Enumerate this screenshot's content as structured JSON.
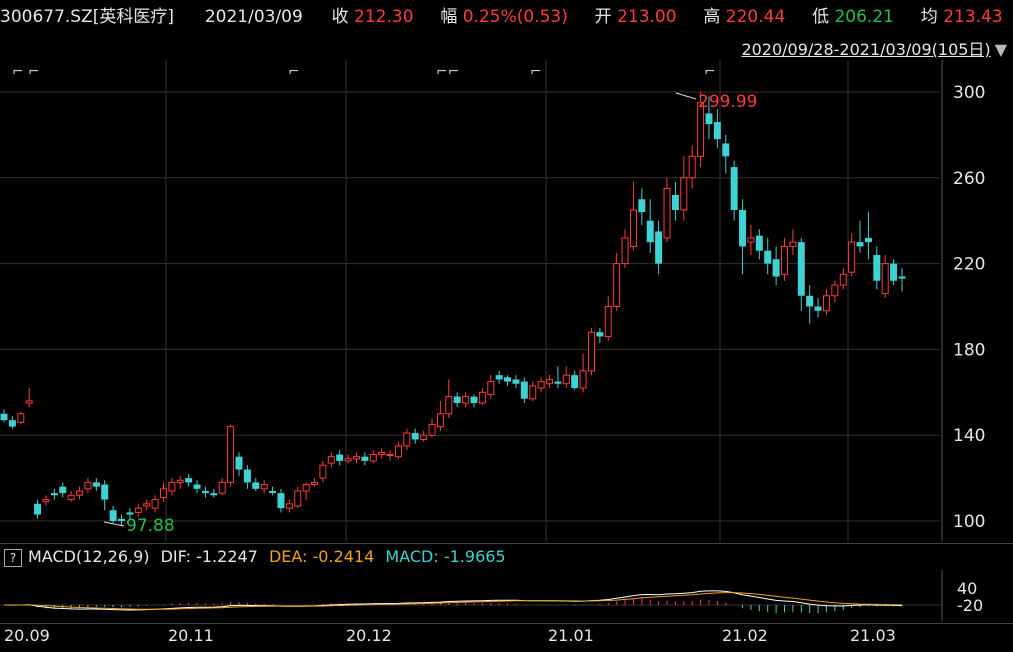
{
  "header": {
    "code": "300677.SZ[英科医疗]",
    "date": "2021/03/09",
    "close_label": "收",
    "close_value": "212.30",
    "change_label": "幅",
    "change_value": "0.25%(0.53)",
    "open_label": "开",
    "open_value": "213.00",
    "high_label": "高",
    "high_value": "220.44",
    "low_label": "低",
    "low_value": "206.21",
    "avg_label": "均",
    "avg_value": "213.43"
  },
  "range_selector": {
    "label": "2020/09/28-2021/03/09(105日)"
  },
  "price_axis": {
    "ticks": [
      "300",
      "260",
      "220",
      "180",
      "140",
      "100"
    ]
  },
  "annotations": {
    "high_marker": "299.99",
    "low_marker": "97.88"
  },
  "macd": {
    "help": "?",
    "title": "MACD(12,26,9)",
    "dif_label": "DIF:",
    "dif_value": "-1.2247",
    "dea_label": "DEA:",
    "dea_value": "-0.2414",
    "macd_label": "MACD:",
    "macd_value": "-1.9665",
    "axis_ticks": [
      "40",
      "-20"
    ]
  },
  "x_axis": {
    "labels": [
      "20.09",
      "20.11",
      "20.12",
      "21.01",
      "21.02",
      "21.03"
    ]
  },
  "colors": {
    "up": "#ff3b3b",
    "down": "#3fd2d2",
    "dif": "#ffffff",
    "dea": "#f2a11b",
    "grid": "#333333"
  },
  "chart_data": {
    "type": "candlestick",
    "y_range": [
      90,
      310
    ],
    "candles": [
      [
        150,
        147,
        152,
        146
      ],
      [
        147,
        144,
        149,
        143
      ],
      [
        146,
        150,
        151,
        145
      ],
      [
        155,
        156,
        162,
        153
      ],
      [
        108,
        103,
        110,
        101
      ],
      [
        109,
        110,
        112,
        107
      ],
      [
        113,
        112,
        115,
        110
      ],
      [
        116,
        113,
        118,
        111
      ],
      [
        110,
        112,
        114,
        109
      ],
      [
        112,
        114,
        116,
        110
      ],
      [
        115,
        118,
        120,
        113
      ],
      [
        118,
        116,
        120,
        114
      ],
      [
        117,
        110,
        119,
        105
      ],
      [
        105,
        100,
        107,
        99
      ],
      [
        101,
        100,
        103,
        98
      ],
      [
        104,
        103,
        106,
        101
      ],
      [
        104,
        106,
        108,
        102
      ],
      [
        107,
        108,
        110,
        105
      ],
      [
        106,
        110,
        112,
        104
      ],
      [
        111,
        115,
        118,
        109
      ],
      [
        114,
        118,
        120,
        112
      ],
      [
        118,
        119,
        121,
        115
      ],
      [
        120,
        118,
        122,
        116
      ],
      [
        117,
        115,
        119,
        113
      ],
      [
        114,
        113,
        116,
        111
      ],
      [
        113,
        112,
        115,
        111
      ],
      [
        113,
        118,
        120,
        112
      ],
      [
        118,
        144,
        145,
        116
      ],
      [
        130,
        124,
        132,
        121
      ],
      [
        124,
        118,
        126,
        115
      ],
      [
        118,
        115,
        120,
        114
      ],
      [
        115,
        117,
        119,
        113
      ],
      [
        114,
        113,
        116,
        112
      ],
      [
        113,
        106,
        115,
        104
      ],
      [
        106,
        108,
        110,
        104
      ],
      [
        107,
        114,
        116,
        106
      ],
      [
        114,
        117,
        118,
        110
      ],
      [
        117,
        118,
        120,
        116
      ],
      [
        120,
        126,
        128,
        118
      ],
      [
        127,
        130,
        132,
        125
      ],
      [
        131,
        128,
        133,
        126
      ],
      [
        128,
        129,
        131,
        127
      ],
      [
        129,
        130,
        132,
        127
      ],
      [
        130,
        128,
        132,
        126
      ],
      [
        128,
        131,
        133,
        127
      ],
      [
        131,
        132,
        134,
        129
      ],
      [
        131,
        131,
        133,
        128
      ],
      [
        130,
        135,
        137,
        129
      ],
      [
        135,
        141,
        143,
        133
      ],
      [
        141,
        138,
        143,
        136
      ],
      [
        138,
        140,
        142,
        137
      ],
      [
        140,
        145,
        148,
        139
      ],
      [
        144,
        150,
        156,
        142
      ],
      [
        150,
        158,
        166,
        148
      ],
      [
        158,
        155,
        160,
        153
      ],
      [
        155,
        158,
        160,
        153
      ],
      [
        158,
        155,
        159,
        153
      ],
      [
        155,
        160,
        162,
        154
      ],
      [
        159,
        165,
        168,
        157
      ],
      [
        168,
        166,
        170,
        164
      ],
      [
        167,
        165,
        168,
        163
      ],
      [
        166,
        164,
        168,
        162
      ],
      [
        165,
        157,
        167,
        155
      ],
      [
        157,
        163,
        165,
        156
      ],
      [
        162,
        165,
        167,
        160
      ],
      [
        164,
        166,
        168,
        162
      ],
      [
        165,
        164,
        172,
        162
      ],
      [
        164,
        168,
        172,
        162
      ],
      [
        168,
        162,
        170,
        161
      ],
      [
        162,
        170,
        178,
        160
      ],
      [
        170,
        188,
        190,
        168
      ],
      [
        188,
        186,
        190,
        183
      ],
      [
        186,
        200,
        205,
        184
      ],
      [
        200,
        220,
        225,
        198
      ],
      [
        220,
        232,
        236,
        218
      ],
      [
        228,
        245,
        258,
        226
      ],
      [
        250,
        244,
        255,
        238
      ],
      [
        240,
        230,
        250,
        225
      ],
      [
        235,
        220,
        240,
        215
      ],
      [
        232,
        255,
        260,
        230
      ],
      [
        252,
        245,
        258,
        240
      ],
      [
        245,
        260,
        270,
        240
      ],
      [
        260,
        270,
        275,
        255
      ],
      [
        270,
        295,
        300,
        265
      ],
      [
        290,
        285,
        298,
        278
      ],
      [
        286,
        278,
        292,
        274
      ],
      [
        276,
        270,
        280,
        262
      ],
      [
        265,
        245,
        268,
        240
      ],
      [
        245,
        228,
        250,
        215
      ],
      [
        230,
        232,
        238,
        224
      ],
      [
        233,
        226,
        236,
        222
      ],
      [
        226,
        220,
        232,
        215
      ],
      [
        222,
        214,
        228,
        210
      ],
      [
        215,
        228,
        232,
        212
      ],
      [
        228,
        230,
        236,
        224
      ],
      [
        230,
        205,
        232,
        198
      ],
      [
        205,
        200,
        210,
        192
      ],
      [
        200,
        198,
        204,
        195
      ],
      [
        198,
        205,
        208,
        196
      ],
      [
        205,
        210,
        212,
        202
      ],
      [
        210,
        215,
        218,
        208
      ],
      [
        216,
        230,
        234,
        214
      ],
      [
        230,
        228,
        240,
        225
      ],
      [
        232,
        230,
        244,
        222
      ],
      [
        224,
        212,
        228,
        208
      ],
      [
        206,
        220,
        224,
        204
      ],
      [
        220,
        212,
        222,
        210
      ],
      [
        214,
        213,
        218,
        207
      ]
    ]
  }
}
